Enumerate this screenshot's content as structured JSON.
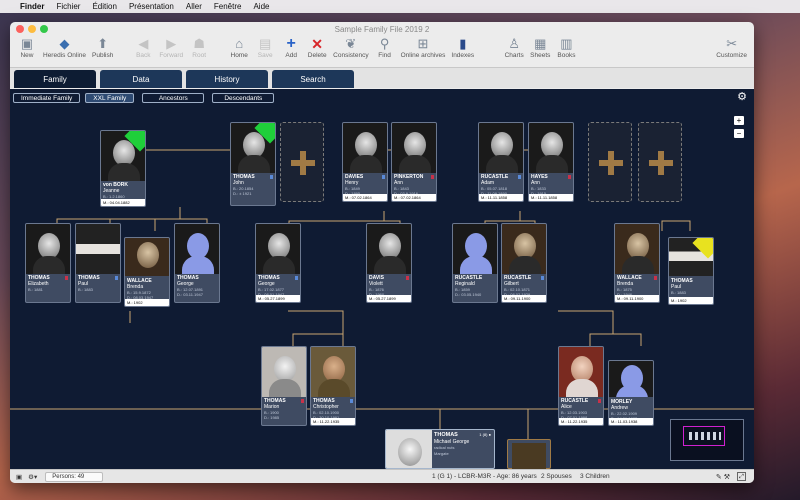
{
  "menubar": {
    "items": [
      "Finder",
      "Fichier",
      "Édition",
      "Présentation",
      "Aller",
      "Fenêtre",
      "Aide"
    ]
  },
  "window": {
    "title": "Sample Family File 2019 2",
    "traffic_colors": [
      "#fc615d",
      "#fdbc40",
      "#34c84a"
    ]
  },
  "toolbar": {
    "items": [
      {
        "label": "New",
        "icon": "new-file-icon",
        "enabled": true
      },
      {
        "label": "Heredis Online",
        "icon": "heredis-online-icon",
        "enabled": true
      },
      {
        "label": "Publish",
        "icon": "publish-icon",
        "enabled": true
      },
      {
        "label": "Back",
        "icon": "back-arrow-icon",
        "enabled": false
      },
      {
        "label": "Forward",
        "icon": "forward-arrow-icon",
        "enabled": false
      },
      {
        "label": "Root",
        "icon": "root-person-icon",
        "enabled": false
      },
      {
        "label": "Home",
        "icon": "home-icon",
        "enabled": true
      },
      {
        "label": "Save",
        "icon": "save-icon",
        "enabled": false
      },
      {
        "label": "Add",
        "icon": "add-icon",
        "enabled": true
      },
      {
        "label": "Delete",
        "icon": "delete-icon",
        "enabled": true
      },
      {
        "label": "Consistency",
        "icon": "consistency-icon",
        "enabled": true
      },
      {
        "label": "Find",
        "icon": "find-icon",
        "enabled": true
      },
      {
        "label": "Online archives",
        "icon": "online-archives-icon",
        "enabled": true
      },
      {
        "label": "Indexes",
        "icon": "indexes-icon",
        "enabled": true
      },
      {
        "label": "Charts",
        "icon": "charts-icon",
        "enabled": true
      },
      {
        "label": "Sheets",
        "icon": "sheets-icon",
        "enabled": true
      },
      {
        "label": "Books",
        "icon": "books-icon",
        "enabled": true
      },
      {
        "label": "Customize",
        "icon": "customize-icon",
        "enabled": true
      }
    ]
  },
  "tabs": [
    "Family",
    "Data",
    "History",
    "Search"
  ],
  "active_tab": "Family",
  "view_buttons": [
    "Immediate Family",
    "XXL Family",
    "Ancestors",
    "Descendants"
  ],
  "selected_view": "XXL Family",
  "tree": {
    "gen3": [
      {
        "last": "von BORK",
        "first": "Jeanne",
        "b": "B.: 1.2.1860",
        "d": "D.: 11.10.1941",
        "marriage": "M.: 04.04.1882",
        "photo": "photo",
        "sex": "f"
      },
      {
        "last": "THOMAS",
        "first": "John",
        "b": "B.: 20.1854",
        "d": "D.: ± 1921",
        "photo": "photo",
        "sex": "m"
      },
      {
        "last": "DAVIES",
        "first": "Henry",
        "b": "B.: 1849",
        "d": "D.: 1895",
        "marriage": "M.: 07.02.1864",
        "photo": "photo",
        "sex": "m"
      },
      {
        "last": "PINKERTON",
        "first": "Ann",
        "b": "B.: 1843",
        "d": "D.: 03.9.1916",
        "marriage": "M.: 07.02.1864",
        "photo": "photo",
        "sex": "f"
      },
      {
        "last": "RUCASTLE",
        "first": "Adam",
        "b": "B.: 05.07.1818",
        "d": "D.: 11.09.1890",
        "marriage": "M.: 11.11.1858",
        "photo": "photo",
        "sex": "m"
      },
      {
        "last": "HAYES",
        "first": "Ann",
        "b": "B.: 1833",
        "d": "D.: 1915",
        "marriage": "M.: 11.11.1858",
        "photo": "photo",
        "sex": "f"
      }
    ],
    "gen2": [
      {
        "last": "THOMAS",
        "first": "Elizabeth",
        "b": "B.: 1881",
        "photo": "photo",
        "sex": "f"
      },
      {
        "last": "THOMAS",
        "first": "Paul",
        "b": "B.: 1883",
        "photo": "mixed",
        "sex": "m"
      },
      {
        "last": "WALLACE",
        "first": "Brenda",
        "b": "B.: 15.9.1872",
        "d": "D.: 08.03.1947",
        "marriage": "M.: 1902",
        "photo": "sepia",
        "sex": "f"
      },
      {
        "last": "THOMAS",
        "first": "George",
        "b": "B.: 12.07.1891",
        "d": "D.: 03.11.1947",
        "photo": "ghost",
        "sex": "m"
      },
      {
        "last": "THOMAS",
        "first": "George",
        "b": "B.: 17.02.1877",
        "d": "D.: 08.01.1947",
        "marriage": "M.: 05.27.1899",
        "photo": "photo",
        "sex": "m"
      },
      {
        "last": "DAVIS",
        "first": "Violett",
        "b": "B.: 1876",
        "d": "D.: 1960",
        "marriage": "M.: 05.27.1899",
        "photo": "photo",
        "sex": "f"
      },
      {
        "last": "RUCASTLE",
        "first": "Reginald",
        "b": "B.: 1859",
        "d": "D.: 03.05.1940",
        "photo": "ghost",
        "sex": "m"
      },
      {
        "last": "RUCASTLE",
        "first": "Gilbert",
        "b": "B.: 02.10.1871",
        "d": "D.: 08.02.1929",
        "marriage": "M.: 09.11.1900",
        "photo": "sepia",
        "sex": "m"
      },
      {
        "last": "WALLACE",
        "first": "Brenda",
        "b": "B.: 1875",
        "d": "D.: 1946",
        "marriage": "M.: 09.11.1900",
        "photo": "sepia",
        "sex": "f"
      },
      {
        "last": "THOMAS",
        "first": "Paul",
        "b": "B.: 1883",
        "marriage": "M.: 1902",
        "photo": "mixed",
        "sex": "m"
      }
    ],
    "gen1": [
      {
        "last": "THOMAS",
        "first": "Marion",
        "b": "B.: 1900",
        "d": "D.: 1985",
        "photo": "light",
        "sex": "f"
      },
      {
        "last": "THOMAS",
        "first": "Christopher",
        "b": "B.: 02.10.1900",
        "d": "D.: 30.10.1991",
        "marriage": "M.: 11.22.1935",
        "photo": "fam",
        "sex": "m"
      },
      {
        "last": "RUCASTLE",
        "first": "Alice",
        "b": "B.: 12.03.1903",
        "d": "D.: 07.01.1998",
        "marriage": "M.: 11.22.1935",
        "photo": "warm",
        "sex": "f"
      },
      {
        "last": "MORLEY",
        "first": "Andrew",
        "b": "B.: 22.02.1909",
        "d": "D.: 14.01.1983",
        "marriage": "M.: 11.03.1938",
        "photo": "ghost",
        "sex": "m"
      }
    ],
    "root": {
      "last": "THOMAS",
      "first": "Michael George",
      "b": "radical nuts",
      "d": "Margate",
      "badge": "1 (8) ●"
    }
  },
  "status": {
    "persons_label": "Persons: 49",
    "center_info": "1 (G 1) - LCBR-M3R - Age: 86 years",
    "spouses": "2 Spouses",
    "children": "3 Children"
  }
}
